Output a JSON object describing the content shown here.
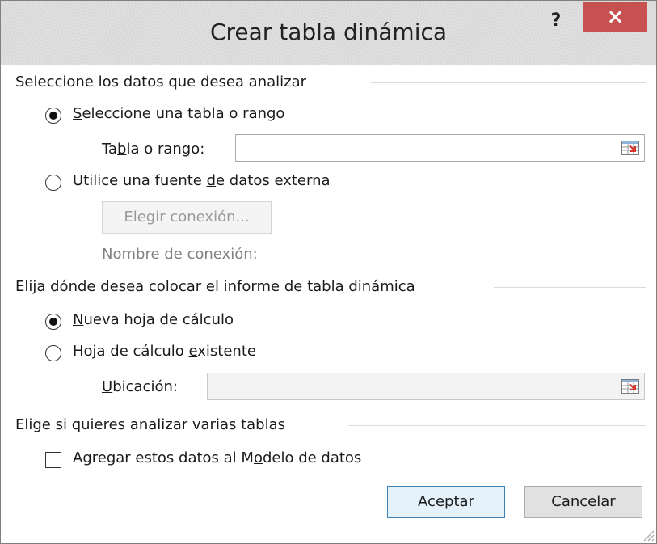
{
  "window": {
    "title": "Crear tabla dinámica",
    "help_label": "?",
    "close_label": "×"
  },
  "section_data": {
    "title": "Seleccione los datos que desea analizar",
    "option_table": {
      "pre": "",
      "u": "S",
      "post": "eleccione una tabla o rango",
      "checked": true
    },
    "range_label": {
      "pre": "Ta",
      "u": "b",
      "post": "la o rango:"
    },
    "range_value": "",
    "option_external": {
      "pre": "Utilice una fuente ",
      "u": "d",
      "post": "e datos externa",
      "checked": false
    },
    "choose_connection_label": "Elegir conexión...",
    "connection_name_label": "Nombre de conexión:"
  },
  "section_location": {
    "title": "Elija dónde desea colocar el informe de tabla dinámica",
    "option_new": {
      "pre": "",
      "u": "N",
      "post": "ueva hoja de cálculo",
      "checked": true
    },
    "option_existing": {
      "pre": "Hoja de cálculo ",
      "u": "e",
      "post": "xistente",
      "checked": false
    },
    "location_label": {
      "pre": "",
      "u": "U",
      "post": "bicación:"
    },
    "location_value": ""
  },
  "section_tables": {
    "title": "Elige si quieres analizar varias tablas",
    "add_model": {
      "pre": "Agregar estos datos al M",
      "u": "o",
      "post": "delo de datos",
      "checked": false
    }
  },
  "buttons": {
    "ok_label": "Aceptar",
    "cancel_label": "Cancelar"
  }
}
